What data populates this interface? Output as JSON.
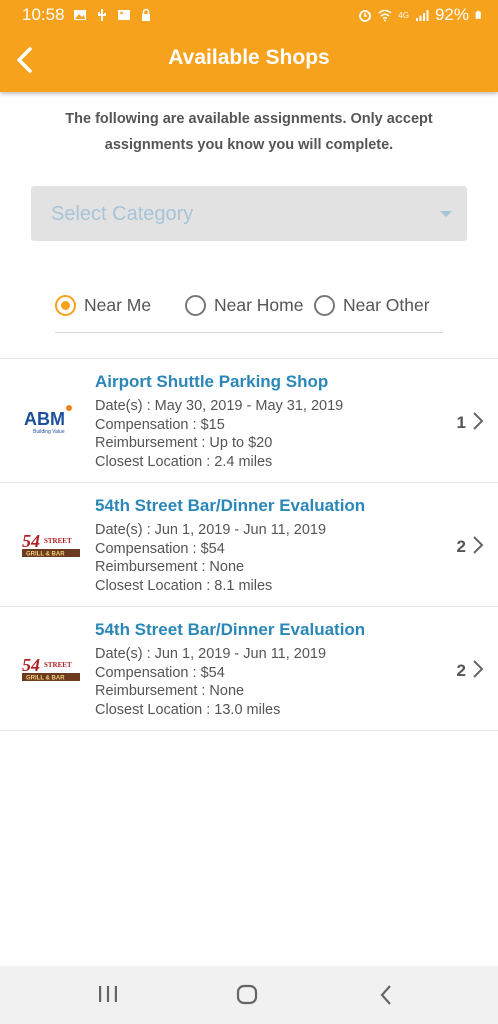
{
  "status_bar": {
    "time": "10:58",
    "battery": "92%",
    "network": "4G"
  },
  "app_bar": {
    "title": "Available Shops"
  },
  "intro_text": "The following are available assignments. Only accept assignments you know you will complete.",
  "category_select": {
    "placeholder": "Select Category"
  },
  "location_filter": {
    "options": [
      {
        "label": "Near Me",
        "selected": true
      },
      {
        "label": "Near Home",
        "selected": false
      },
      {
        "label": "Near Other",
        "selected": false
      }
    ]
  },
  "shops": [
    {
      "title": "Airport Shuttle Parking Shop",
      "logo": "abm-logo",
      "logo_text": "ABM",
      "logo_tagline": "Building Value",
      "dates": "Date(s) : May 30, 2019 - May 31, 2019",
      "compensation": "Compensation : $15",
      "reimbursement": "Reimbursement : Up to $20",
      "closest": "Closest Location : 2.4 miles",
      "count": "1"
    },
    {
      "title": "54th Street Bar/Dinner Evaluation",
      "logo": "54th-street-logo",
      "logo_text": "54th STREET GRILL & BAR",
      "dates": "Date(s) : Jun 1, 2019 - Jun 11, 2019",
      "compensation": "Compensation : $54",
      "reimbursement": "Reimbursement : None",
      "closest": "Closest Location : 8.1 miles",
      "count": "2"
    },
    {
      "title": "54th Street Bar/Dinner Evaluation",
      "logo": "54th-street-logo",
      "logo_text": "54th STREET GRILL & BAR",
      "dates": "Date(s) : Jun 1, 2019 - Jun 11, 2019",
      "compensation": "Compensation : $54",
      "reimbursement": "Reimbursement : None",
      "closest": "Closest Location : 13.0 miles",
      "count": "2"
    }
  ],
  "colors": {
    "accent": "#f6a21c",
    "title_link": "#2a87b8",
    "select_bg": "#e2e2e2",
    "select_placeholder": "#a8c4d8"
  }
}
